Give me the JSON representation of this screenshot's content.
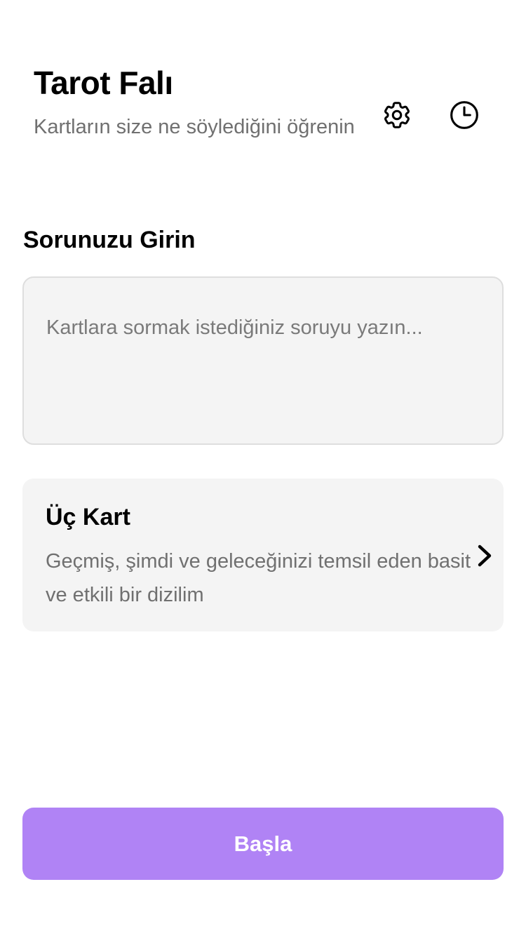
{
  "header": {
    "title": "Tarot Falı",
    "subtitle": "Kartların size ne söylediğini öğrenin",
    "settings_icon": "gear-icon",
    "history_icon": "clock-icon"
  },
  "question": {
    "label": "Sorunuzu Girin",
    "value": "",
    "placeholder": "Kartlara sormak istediğiniz soruyu yazın..."
  },
  "spread": {
    "title": "Üç Kart",
    "description": "Geçmiş, şimdi ve geleceğinizi temsil eden basit ve etkili bir dizilim",
    "chevron_icon": "chevron-right-icon"
  },
  "actions": {
    "start_label": "Başla"
  },
  "colors": {
    "accent": "#b083f5",
    "field_background": "#f4f4f4",
    "secondary_text": "#707070"
  }
}
